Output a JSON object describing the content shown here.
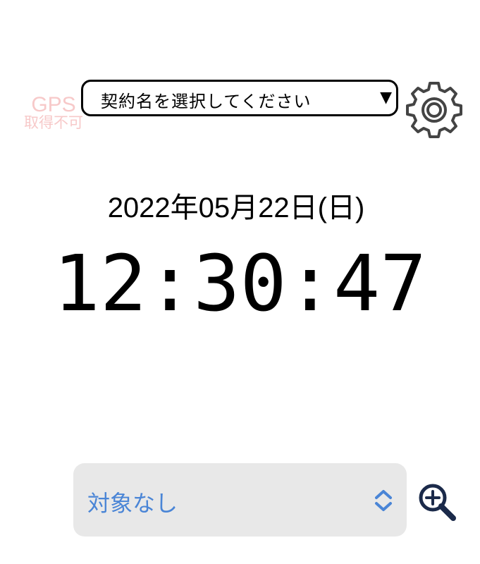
{
  "gps_status": {
    "line1": "GPS",
    "line2": "取得不可"
  },
  "contract": {
    "placeholder": "契約名を選択してください",
    "caret": "▼"
  },
  "settings": {
    "icon": "gear-icon"
  },
  "clock": {
    "date": "2022年05月22日(日)",
    "time": "12:30:47"
  },
  "target": {
    "selected": "対象なし",
    "icon": "chevron-up-down-icon"
  },
  "search": {
    "icon": "zoom-in-icon"
  },
  "colors": {
    "gps_text": "#f7c9c9",
    "target_text": "#4a85d6",
    "target_bg": "#e8e8e8",
    "zoom_icon": "#1b2a4a"
  }
}
